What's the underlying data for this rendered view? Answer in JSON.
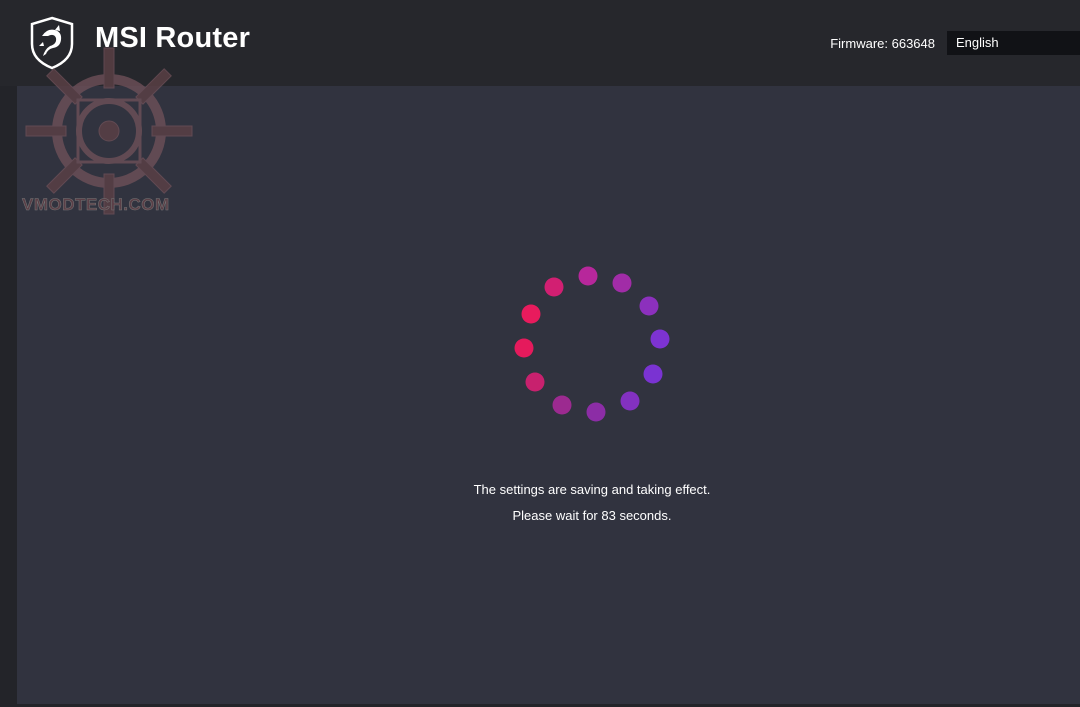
{
  "header": {
    "brand": "MSI Router",
    "firmware_label": "Firmware: 663648",
    "language": "English"
  },
  "watermark": {
    "text": "VMODTECH.COM"
  },
  "status": {
    "line1": "The settings are saving and taking effect.",
    "line2_prefix": "Please wait for ",
    "seconds": "83",
    "line2_suffix": " seconds."
  },
  "colors": {
    "background": "#31333f",
    "header": "#26272c",
    "spinner_start": "#e8195a",
    "spinner_end": "#7b33d6"
  }
}
